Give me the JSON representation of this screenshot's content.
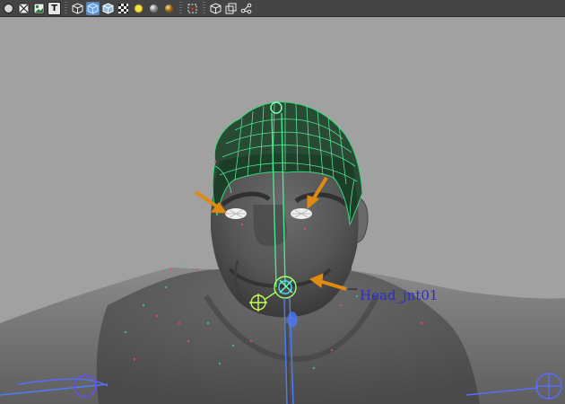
{
  "toolbar": {
    "tools": [
      {
        "icon": "shading-menu-icon"
      },
      {
        "icon": "wireframe-x-icon"
      },
      {
        "icon": "image-plane-icon"
      },
      {
        "icon": "texture-t-icon",
        "label": "T"
      },
      {
        "icon": "wireframe-cube-icon"
      },
      {
        "icon": "smooth-shade-cube-icon"
      },
      {
        "icon": "shaded-wireframe-cube-icon"
      },
      {
        "icon": "checker-texture-icon"
      },
      {
        "icon": "default-light-icon"
      },
      {
        "icon": "all-lights-icon"
      },
      {
        "icon": "shadows-icon"
      },
      {
        "icon": "isolate-select-icon"
      },
      {
        "icon": "xray-cube-icon"
      },
      {
        "icon": "xray-active-components-icon"
      },
      {
        "icon": "xray-joints-icon"
      }
    ]
  },
  "viewport": {
    "background_color": "#a1a1a1",
    "annotation": {
      "label": "Head_jnt01",
      "color": "#2b2bd6"
    },
    "wireframe_color": "#39d67a",
    "arrow_color": "#e08a12",
    "joint_color": "#4a7cff"
  }
}
